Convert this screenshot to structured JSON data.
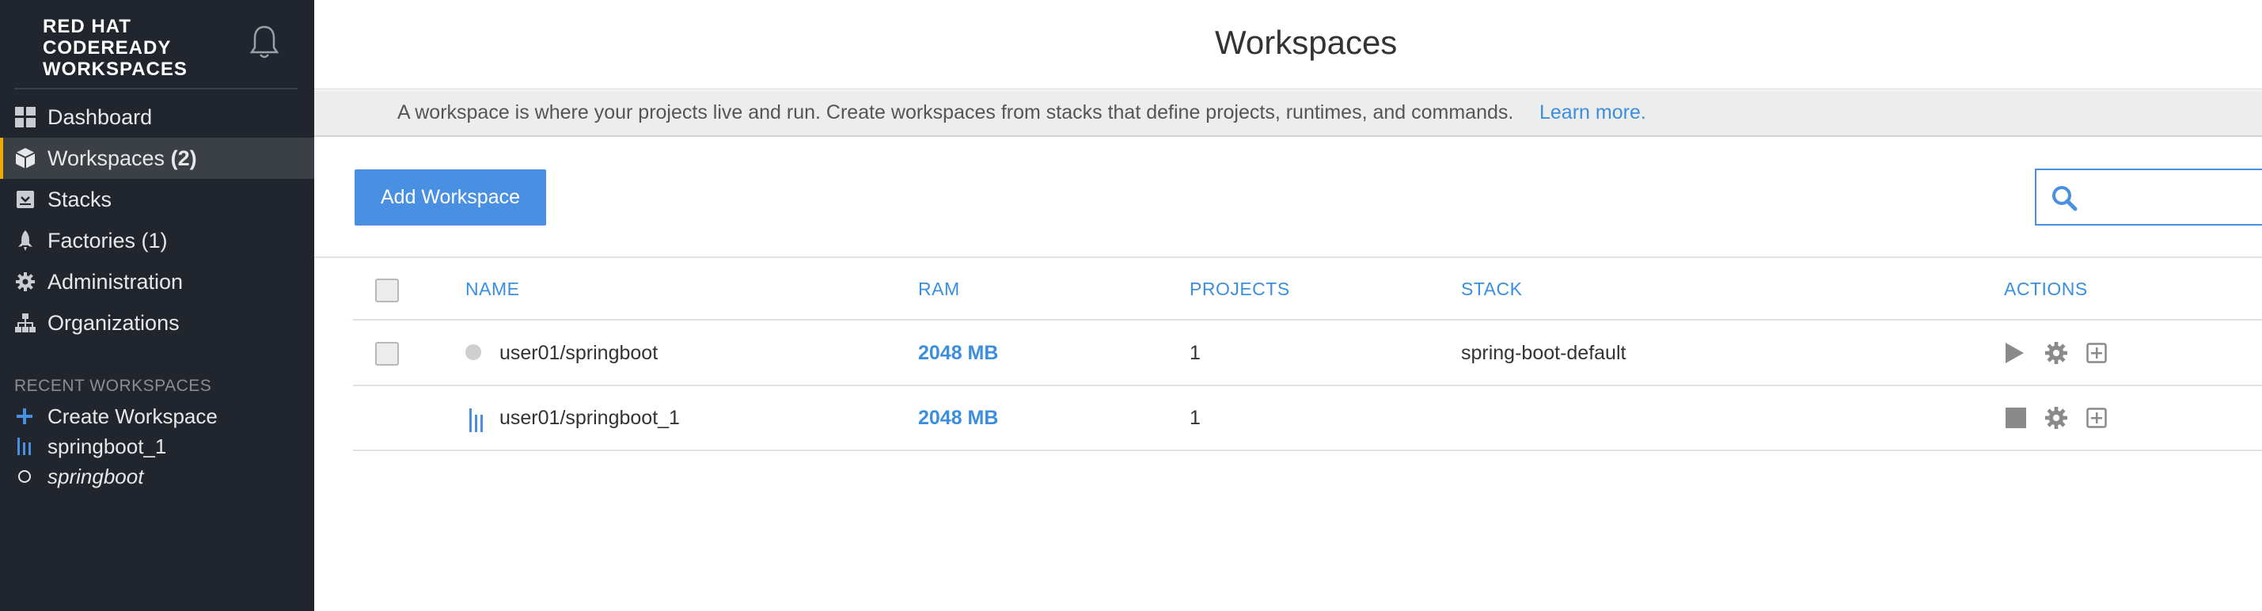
{
  "app": {
    "logo_line1": "RED HAT",
    "logo_line2": "CODEREADY",
    "logo_line3": "WORKSPACES"
  },
  "sidebar": {
    "items": [
      {
        "label": "Dashboard",
        "icon": "dashboard-icon"
      },
      {
        "label": "Workspaces",
        "count": "(2)",
        "icon": "cube-icon",
        "active": true
      },
      {
        "label": "Stacks",
        "icon": "stack-icon"
      },
      {
        "label": "Factories (1)",
        "icon": "rocket-icon"
      },
      {
        "label": "Administration",
        "icon": "gear-icon"
      },
      {
        "label": "Organizations",
        "icon": "org-icon"
      }
    ],
    "recent_title": "RECENT WORKSPACES",
    "recent": [
      {
        "label": "Create Workspace",
        "icon": "plus-icon"
      },
      {
        "label": "springboot_1",
        "icon": "running-bars-icon"
      },
      {
        "label": "springboot",
        "icon": "stopped-circle-icon"
      }
    ]
  },
  "header": {
    "title": "Workspaces"
  },
  "info": {
    "text": "A workspace is where your projects live and run. Create workspaces from stacks that define projects, runtimes, and commands.",
    "link": "Learn more."
  },
  "toolbar": {
    "add_label": "Add Workspace",
    "search_placeholder": ""
  },
  "table": {
    "columns": [
      "NAME",
      "RAM",
      "PROJECTS",
      "STACK",
      "ACTIONS"
    ],
    "rows": [
      {
        "name": "user01/springboot",
        "ram": "2048 MB",
        "projects": "1",
        "stack": "spring-boot-default",
        "status": "stopped"
      },
      {
        "name": "user01/springboot_1",
        "ram": "2048 MB",
        "projects": "1",
        "stack": "",
        "status": "running"
      }
    ]
  },
  "colors": {
    "sidebar_bg": "#21252d",
    "accent_blue": "#4a90e2",
    "active_marker": "#f0ab00"
  }
}
